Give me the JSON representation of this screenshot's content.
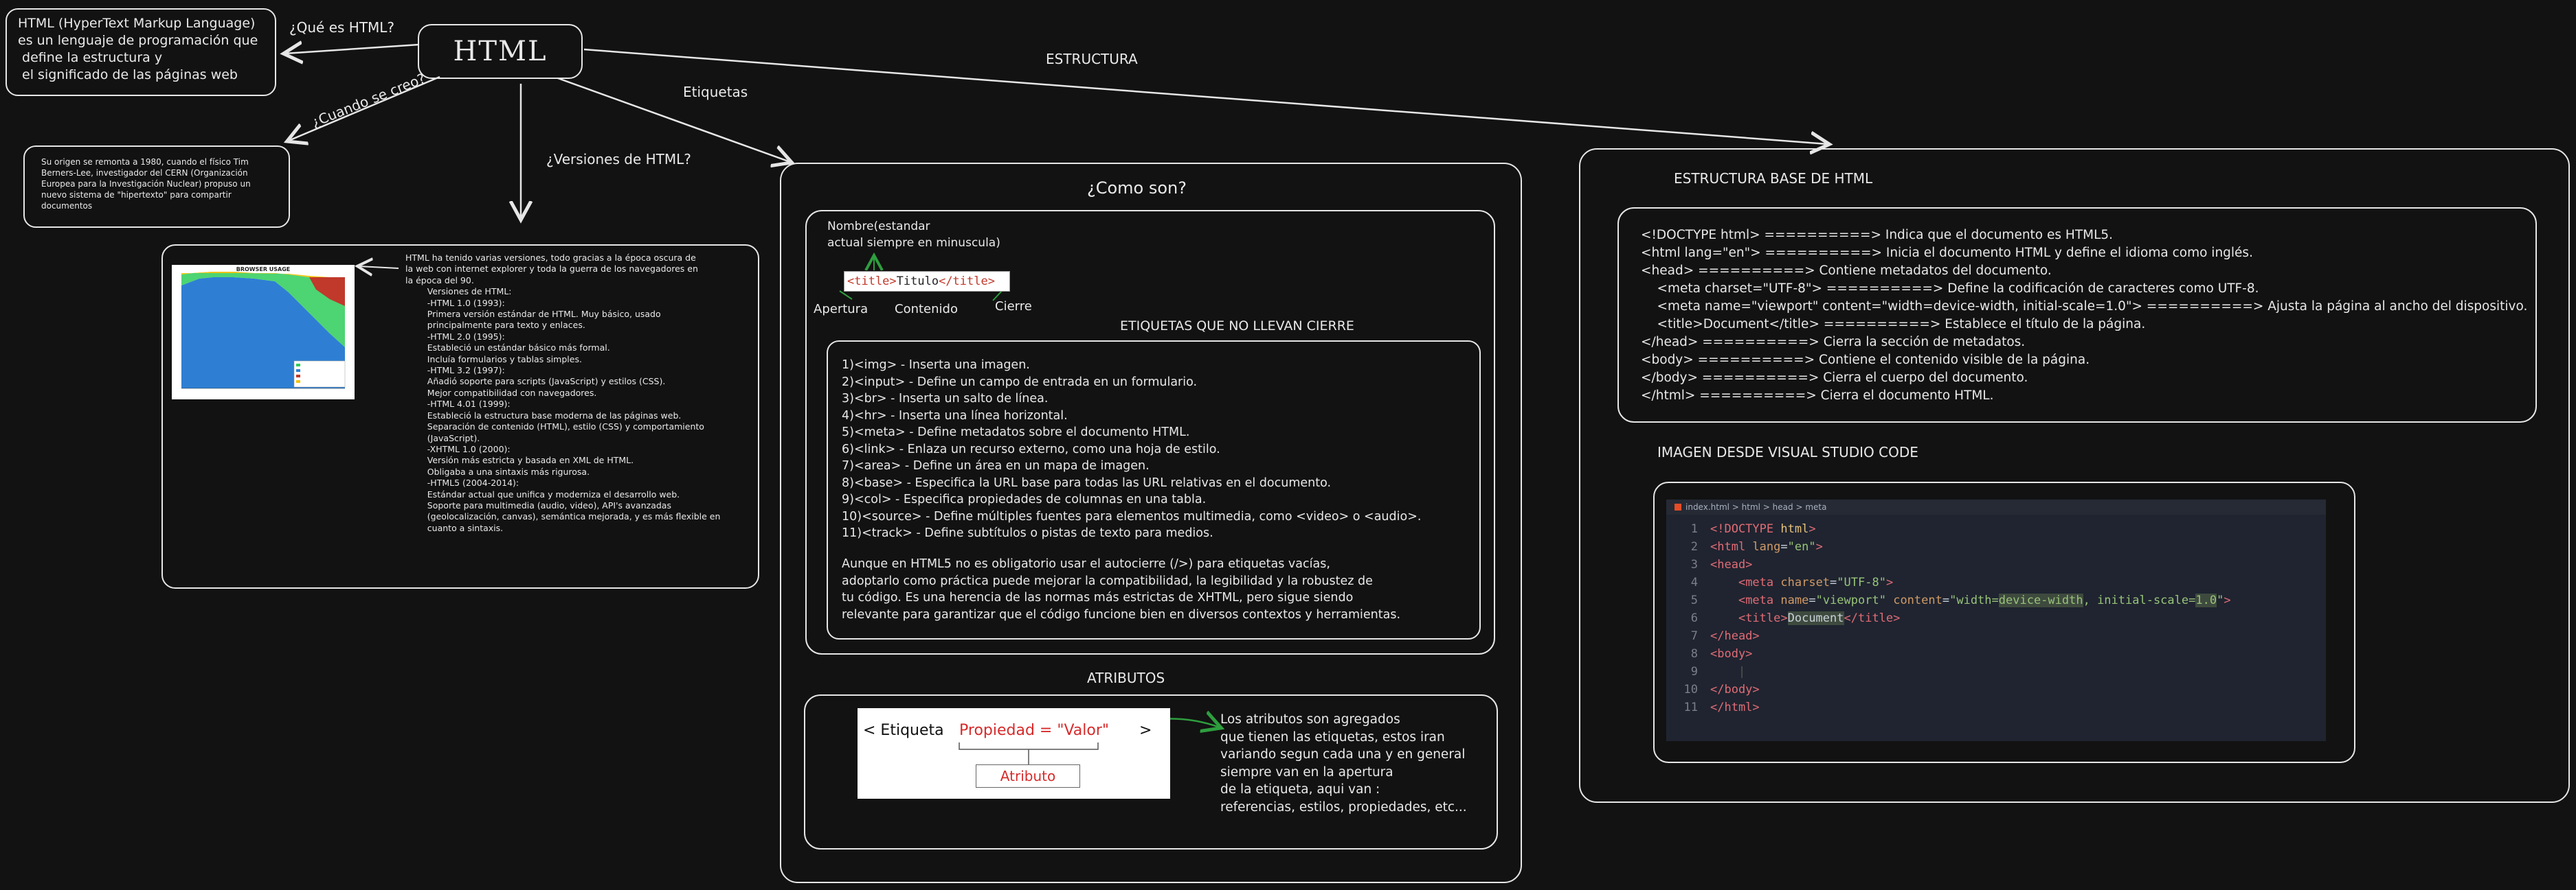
{
  "html_node": {
    "title": "HTML"
  },
  "definition": {
    "text": "HTML (HyperText Markup Language)\nes un lenguaje de programación que\n define la estructura y\n el significado de las páginas web"
  },
  "edges": {
    "que_es": "¿Qué es HTML?",
    "cuando": "¿Cuando se creo?",
    "versiones": "¿Versiones de HTML?",
    "etiquetas": "Etiquetas",
    "estructura": "ESTRUCTURA"
  },
  "origin": {
    "text": "Su origen se remonta a 1980, cuando el físico Tim\nBerners-Lee, investigador del CERN (Organización\nEuropea para la Investigación Nuclear) propuso un\nnuevo sistema de \"hipertexto\" para compartir\ndocumentos"
  },
  "versions": {
    "chart_title": "BROWSER USAGE",
    "text": "HTML ha tenido varias versiones, todo gracias a la época oscura de\nla web con internet explorer y toda la guerra de los navegadores en\nla época del 90.\n        Versiones de HTML:\n        -HTML 1.0 (1993):\n        Primera versión estándar de HTML. Muy básico, usado\n        principalmente para texto y enlaces.\n        -HTML 2.0 (1995):\n        Estableció un estándar básico más formal.\n        Incluía formularios y tablas simples.\n        -HTML 3.2 (1997):\n        Añadió soporte para scripts (JavaScript) y estilos (CSS).\n        Mejor compatibilidad con navegadores.\n        -HTML 4.01 (1999):\n        Estableció la estructura base moderna de las páginas web.\n        Separación de contenido (HTML), estilo (CSS) y comportamiento\n        (JavaScript).\n        -XHTML 1.0 (2000):\n        Versión más estricta y basada en XML de HTML.\n        Obligaba a una sintaxis más rigurosa.\n        -HTML5 (2004-2014):\n        Estándar actual que unifica y moderniza el desarrollo web.\n        Soporte para multimedia (audio, video), API's avanzadas\n        (geolocalización, canvas), semántica mejorada, y es más flexible en\n        cuanto a sintaxis."
  },
  "como_son": {
    "title": "¿Como son?",
    "nombre_note": "Nombre(estandar\nactual siempre en minuscula)",
    "tag_open": "<title>",
    "tag_content": "Titulo",
    "tag_close": "</title>",
    "apertura": "Apertura",
    "contenido": "Contenido",
    "cierre": "Cierre",
    "no_cierre_title": "ETIQUETAS QUE NO LLEVAN CIERRE",
    "items": [
      "1)<img> - Inserta una imagen.",
      "2)<input> - Define un campo de entrada en un formulario.",
      "3)<br> - Inserta un salto de línea.",
      "4)<hr> - Inserta una línea horizontal.",
      "5)<meta> - Define metadatos sobre el documento HTML.",
      "6)<link> - Enlaza un recurso externo, como una hoja de estilo.",
      "7)<area> - Define un área en un mapa de imagen.",
      "8)<base> - Especifica la URL base para todas las URL relativas en el documento.",
      "9)<col> - Especifica propiedades de columnas en una tabla.",
      "10)<source> - Define múltiples fuentes para elementos multimedia, como <video> o <audio>.",
      "11)<track> - Define subtítulos o pistas de texto para medios."
    ],
    "note": "Aunque en HTML5 no es obligatorio usar el autocierre (/>) para etiquetas vacías,\nadoptarlo como práctica puede mejorar la compatibilidad, la legibilidad y la robustez de\ntu código. Es una herencia de las normas más estrictas de XHTML, pero sigue siendo\nrelevante para garantizar que el código funcione bien en diversos contextos y herramientas."
  },
  "atributos": {
    "title": "ATRIBUTOS",
    "etiqueta": "< Etiqueta",
    "propiedad": "Propiedad = \"Valor\"",
    "cierre": ">",
    "atributo": "Atributo",
    "text": "Los atributos son agregados\nque tienen las etiquetas, estos iran\nvariando segun cada una y en general\nsiempre van en la apertura\nde la etiqueta, aqui van :\nreferencias, estilos, propiedades, etc..."
  },
  "estructura": {
    "title": "ESTRUCTURA BASE DE HTML",
    "lines": [
      "<!DOCTYPE html> ==========> Indica que el documento es HTML5.",
      "<html lang=\"en\"> ==========> Inicia el documento HTML y define el idioma como inglés.",
      "<head> ==========> Contiene metadatos del documento.",
      "    <meta charset=\"UTF-8\"> ==========> Define la codificación de caracteres como UTF-8.",
      "    <meta name=\"viewport\" content=\"width=device-width, initial-scale=1.0\"> ==========> Ajusta la página al ancho del dispositivo.",
      "    <title>Document</title> ==========> Establece el título de la página.",
      "</head> ==========> Cierra la sección de metadatos.",
      "<body> ==========> Contiene el contenido visible de la página.",
      "</body> ==========> Cierra el cuerpo del documento.",
      "</html> ==========> Cierra el documento HTML."
    ],
    "vs_title": "IMAGEN DESDE VISUAL STUDIO CODE",
    "breadcrumb": "index.html > html > head > meta",
    "code_lines": [
      {
        "n": "1",
        "html": "<span style='color:#e06c75'>&lt;!DOCTYPE</span> <span style='color:#e5c07b'>html</span><span style='color:#e06c75'>&gt;</span>"
      },
      {
        "n": "2",
        "html": "<span style='color:#e06c75'>&lt;html</span> <span style='color:#d19a66'>lang</span>=<span style='color:#98c379'>\"en\"</span><span style='color:#e06c75'>&gt;</span>"
      },
      {
        "n": "3",
        "html": "<span style='color:#e06c75'>&lt;head&gt;</span>"
      },
      {
        "n": "4",
        "html": "    <span style='color:#e06c75'>&lt;meta</span> <span style='color:#d19a66'>charset</span>=<span style='color:#98c379'>\"UTF-8\"</span><span style='color:#e06c75'>&gt;</span>"
      },
      {
        "n": "5",
        "html": "    <span style='color:#e06c75'>&lt;meta</span> <span style='color:#d19a66'>name</span>=<span style='color:#98c379'>\"viewport\"</span> <span style='color:#d19a66'>content</span>=<span style='color:#98c379'>\"width=<span style='background:#3e4a3e'>device-width</span>, initial-scale=<span style='background:#3e4a3e'>1.0</span>\"</span><span style='color:#e06c75'>&gt;</span>"
      },
      {
        "n": "6",
        "html": "    <span style='color:#e06c75'>&lt;title&gt;</span><span style='background:#3e4a3e'>Document</span><span style='color:#e06c75'>&lt;/title&gt;</span>"
      },
      {
        "n": "7",
        "html": "<span style='color:#e06c75'>&lt;/head&gt;</span>"
      },
      {
        "n": "8",
        "html": "<span style='color:#e06c75'>&lt;body&gt;</span>"
      },
      {
        "n": "9",
        "html": "    <span style='color:#555'>|</span>"
      },
      {
        "n": "10",
        "html": "<span style='color:#e06c75'>&lt;/body&gt;</span>"
      },
      {
        "n": "11",
        "html": "<span style='color:#e06c75'>&lt;/html&gt;</span>"
      }
    ]
  }
}
